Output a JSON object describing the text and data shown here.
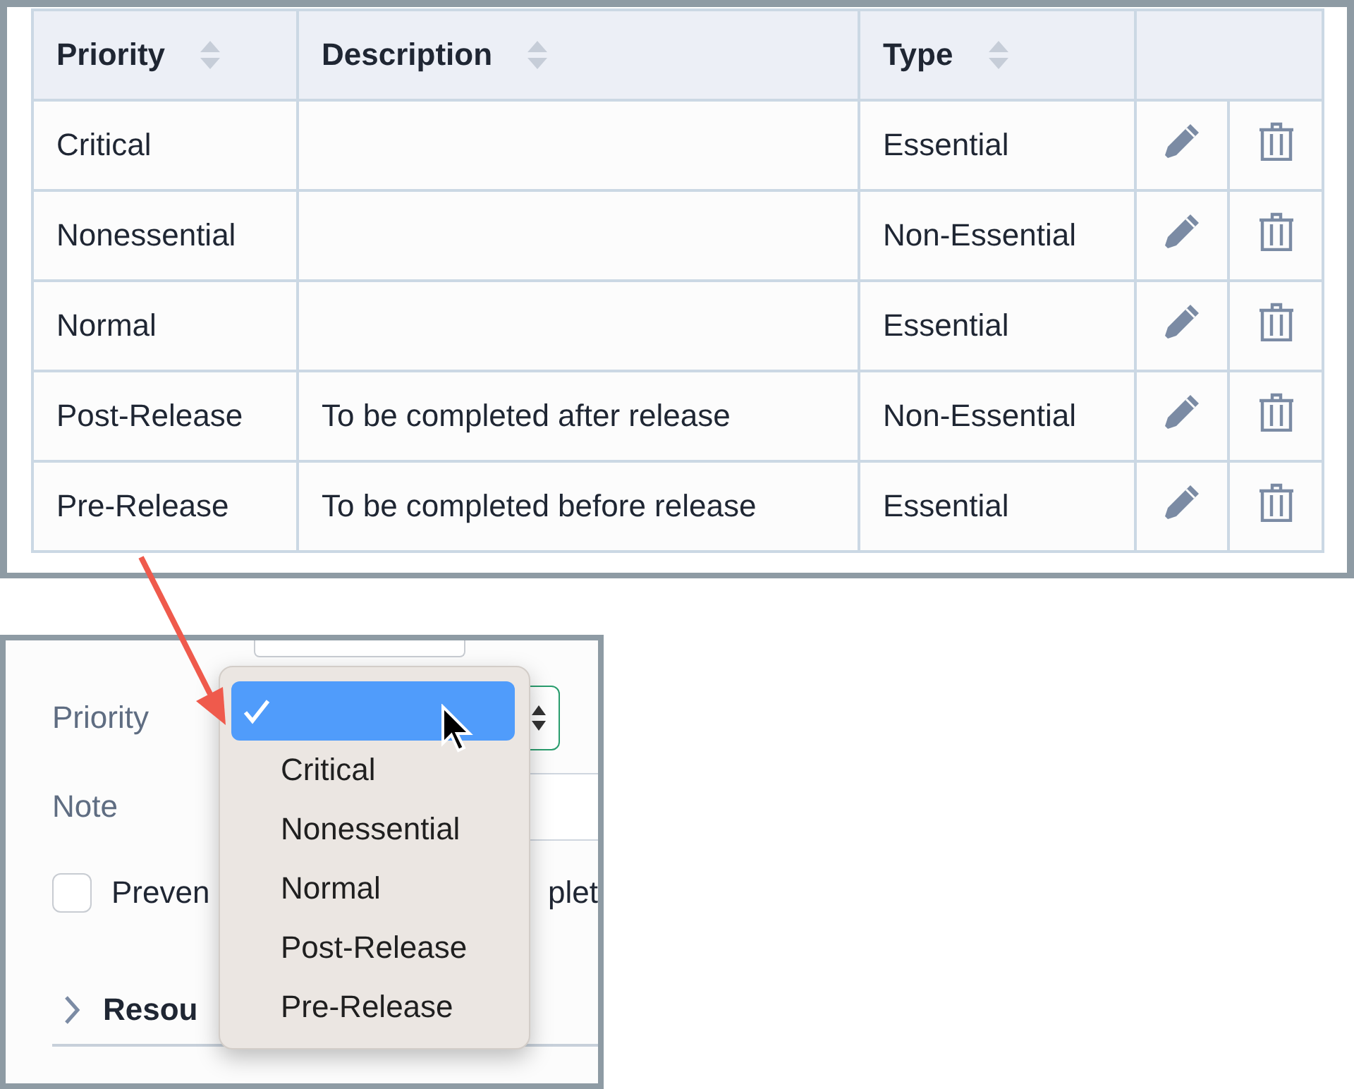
{
  "table": {
    "columns": [
      {
        "label": "Priority"
      },
      {
        "label": "Description"
      },
      {
        "label": "Type"
      }
    ],
    "rows": [
      {
        "priority": "Critical",
        "type": "Essential"
      },
      {
        "priority": "Nonessential",
        "type": "Non-Essential"
      },
      {
        "priority": "Normal",
        "type": "Essential"
      },
      {
        "priority": "Post-Release",
        "description": "To be completed after release",
        "type": "Non-Essential"
      },
      {
        "priority": "Pre-Release",
        "description": "To be completed before release",
        "type": "Essential"
      }
    ]
  },
  "form": {
    "priority_label": "Priority",
    "note_label": "Note",
    "checkbox": {
      "label_start": "Preven",
      "label_end": "plet",
      "checked": false
    },
    "section": {
      "title": "Resou",
      "expanded": false
    }
  },
  "menu": {
    "options": [
      {
        "selected": true
      },
      {
        "label": "Critical",
        "selected": false
      },
      {
        "label": "Nonessential",
        "selected": false
      },
      {
        "label": "Normal",
        "selected": false
      },
      {
        "label": "Post-Release",
        "selected": false
      },
      {
        "label": "Pre-Release",
        "selected": false
      }
    ]
  }
}
